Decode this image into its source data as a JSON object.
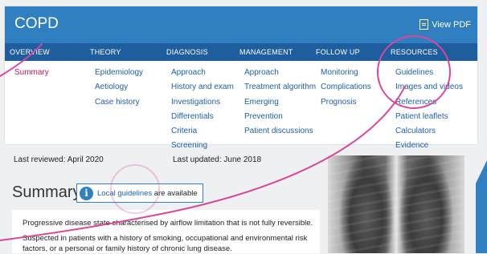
{
  "header": {
    "title": "COPD",
    "pdf_label": "View PDF"
  },
  "nav": {
    "columns": [
      {
        "heading": "OVERVIEW",
        "links": [
          {
            "label": "Summary",
            "active": true
          }
        ]
      },
      {
        "heading": "THEORY",
        "links": [
          {
            "label": "Epidemiology"
          },
          {
            "label": "Aetiology"
          },
          {
            "label": "Case history"
          }
        ]
      },
      {
        "heading": "DIAGNOSIS",
        "links": [
          {
            "label": "Approach"
          },
          {
            "label": "History and exam"
          },
          {
            "label": "Investigations"
          },
          {
            "label": "Differentials"
          },
          {
            "label": "Criteria"
          },
          {
            "label": "Screening"
          }
        ]
      },
      {
        "heading": "MANAGEMENT",
        "links": [
          {
            "label": "Approach"
          },
          {
            "label": "Treatment algorithm"
          },
          {
            "label": "Emerging"
          },
          {
            "label": "Prevention"
          },
          {
            "label": "Patient discussions"
          }
        ]
      },
      {
        "heading": "FOLLOW UP",
        "links": [
          {
            "label": "Monitoring"
          },
          {
            "label": "Complications"
          },
          {
            "label": "Prognosis"
          }
        ]
      },
      {
        "heading": "RESOURCES",
        "links": [
          {
            "label": "Guidelines"
          },
          {
            "label": "Images and videos"
          },
          {
            "label": "References"
          },
          {
            "label": "Patient leaflets"
          },
          {
            "label": "Calculators"
          },
          {
            "label": "Evidence"
          }
        ]
      }
    ]
  },
  "meta": {
    "last_reviewed": "Last reviewed: April 2020",
    "last_updated": "Last updated: June  2018"
  },
  "summary": {
    "title": "Summary",
    "guidelines_link": "Local guidelines",
    "guidelines_suffix": " are available",
    "paragraphs": [
      "Progressive disease state characterised by airflow limitation that is not fully reversible.",
      "Suspected in patients with a history of smoking, occupational and environmental risk factors, or a personal or family history of chronic lung disease."
    ]
  },
  "colors": {
    "header_blue": "#2f7fc1",
    "nav_blue": "#1e5d9e",
    "link_blue": "#1f5fa8",
    "active_pink": "#c8125a",
    "annotation_pink": "#d9479a"
  }
}
